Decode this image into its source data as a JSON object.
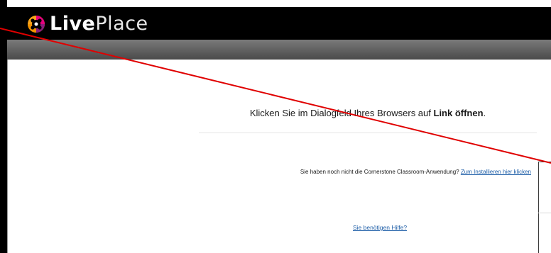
{
  "brand": {
    "name_bold": "Live",
    "name_light": "Place",
    "colors": {
      "header": "#000000",
      "subbar": "#5a5a5a",
      "link": "#1f5fa8",
      "annotation": "#e00000"
    }
  },
  "main": {
    "instruction_prefix": "Klicken Sie im Dialogfeld Ihres Browsers auf ",
    "instruction_bold": "Link öffnen",
    "instruction_suffix": ".",
    "install_text": "Sie haben noch nicht die Cornerstone Classroom-Anwendung? ",
    "install_link": "Zum Installieren hier klicken",
    "help_link": "Sie benötigen Hilfe?"
  }
}
